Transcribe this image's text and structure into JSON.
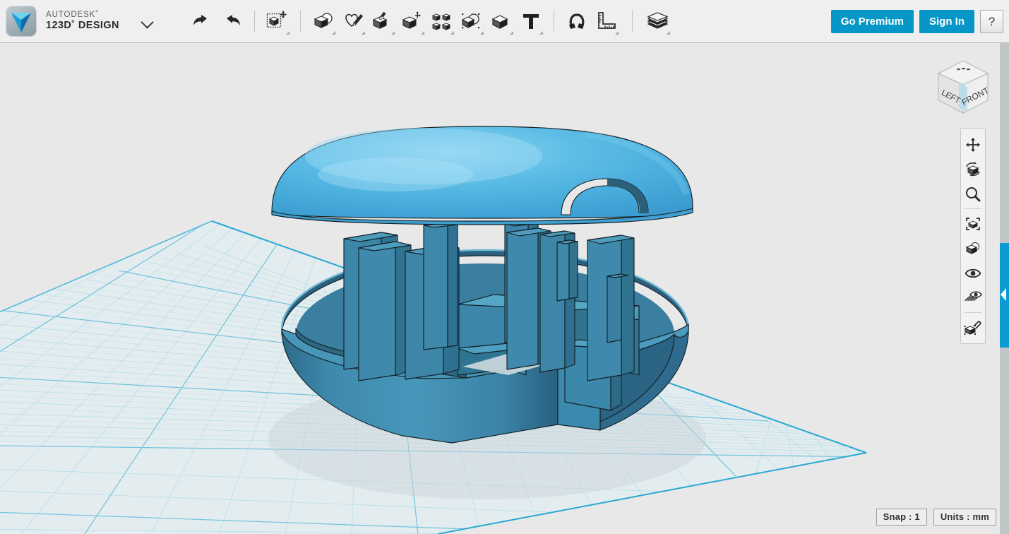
{
  "app": {
    "brand_top": "AUTODESK˚",
    "brand_bottom": "123D˚ DESIGN",
    "logo_icon": "autodesk-123d-logo",
    "menu_caret_icon": "chevron-down-icon"
  },
  "toolbar": {
    "groups": [
      {
        "name": "history",
        "tools": [
          {
            "id": "undo",
            "icon": "undo-arrow-icon",
            "label": "Undo",
            "has_menu": false
          },
          {
            "id": "redo",
            "icon": "redo-arrow-icon",
            "label": "Redo",
            "has_menu": false
          }
        ]
      },
      {
        "name": "transform",
        "tools": [
          {
            "id": "transform",
            "icon": "transform-cube-move-icon",
            "label": "Transform",
            "has_menu": true
          }
        ]
      },
      {
        "name": "modeling",
        "tools": [
          {
            "id": "primitives",
            "icon": "primitives-cube-sphere-icon",
            "label": "Primitives",
            "has_menu": true
          },
          {
            "id": "sketch",
            "icon": "sketch-pencil-icon",
            "label": "Sketch",
            "has_menu": true
          },
          {
            "id": "construct",
            "icon": "construct-cube-brush-icon",
            "label": "Construct",
            "has_menu": true
          },
          {
            "id": "modify",
            "icon": "modify-cube-arrow-icon",
            "label": "Modify",
            "has_menu": true
          },
          {
            "id": "pattern",
            "icon": "pattern-four-cubes-icon",
            "label": "Pattern",
            "has_menu": true
          },
          {
            "id": "grouping",
            "icon": "grouping-cube-circle-icon",
            "label": "Grouping",
            "has_menu": true
          },
          {
            "id": "combine",
            "icon": "combine-cube-icon",
            "label": "Combine",
            "has_menu": true
          },
          {
            "id": "text",
            "icon": "text-t-icon",
            "label": "Text",
            "has_menu": true
          }
        ]
      },
      {
        "name": "measure",
        "tools": [
          {
            "id": "snap",
            "icon": "magnet-snap-icon",
            "label": "Snap",
            "has_menu": false
          },
          {
            "id": "measure",
            "icon": "ruler-measure-icon",
            "label": "Measure",
            "has_menu": true
          }
        ]
      },
      {
        "name": "materials",
        "tools": [
          {
            "id": "material",
            "icon": "material-stack-icon",
            "label": "Material",
            "has_menu": true
          }
        ]
      }
    ],
    "go_premium_label": "Go Premium",
    "sign_in_label": "Sign In",
    "help_label": "?"
  },
  "viewcube": {
    "icon": "view-cube-icon",
    "face_left": "LEFT",
    "face_front": "FRONT",
    "highlight_color": "#b8dcea"
  },
  "navbar": {
    "items": [
      {
        "id": "pan",
        "icon": "pan-four-arrows-icon",
        "label": "Pan"
      },
      {
        "id": "orbit",
        "icon": "orbit-cube-icon",
        "label": "Orbit"
      },
      {
        "id": "zoom",
        "icon": "magnifier-zoom-icon",
        "label": "Zoom"
      },
      {
        "id": "fit",
        "icon": "fit-to-window-icon",
        "label": "Fit"
      },
      {
        "id": "objects",
        "icon": "object-visibility-icon",
        "label": "Objects"
      },
      {
        "id": "visibility",
        "icon": "eye-icon",
        "label": "Visibility"
      },
      {
        "id": "grid",
        "icon": "grid-display-icon",
        "label": "Grid / Snaps"
      },
      {
        "id": "appearance",
        "icon": "material-paint-icon",
        "label": "Appearance"
      }
    ]
  },
  "panel": {
    "tab_icon": "chevron-left-icon",
    "tab_color": "#0b9ad1"
  },
  "status": {
    "snap": "Snap : 1",
    "units": "Units : mm"
  },
  "scene": {
    "name": "3d-model-dome-pavilion",
    "background_color": "#e8e8e8",
    "grid_fill": "#e3ecee",
    "grid_minor_color": "#a9dcec",
    "grid_major_color": "#7ecbe4",
    "grid_edge_color": "#29a8d4",
    "dome_color": "#4eb3e0",
    "dome_highlight": "#8fd4f0",
    "body_color": "#3d86a8",
    "body_dark": "#2c6382",
    "body_light": "#4e9ec0",
    "outline_color": "#1c2b33",
    "objects": [
      {
        "name": "dome-roof",
        "type": "dome"
      },
      {
        "name": "circular-wall",
        "type": "cylindrical-shell"
      },
      {
        "name": "interior-walls",
        "type": "partition-walls"
      },
      {
        "name": "column-array",
        "type": "columns",
        "count": 9
      },
      {
        "name": "arched-doorway",
        "type": "arch-cutout"
      }
    ]
  }
}
